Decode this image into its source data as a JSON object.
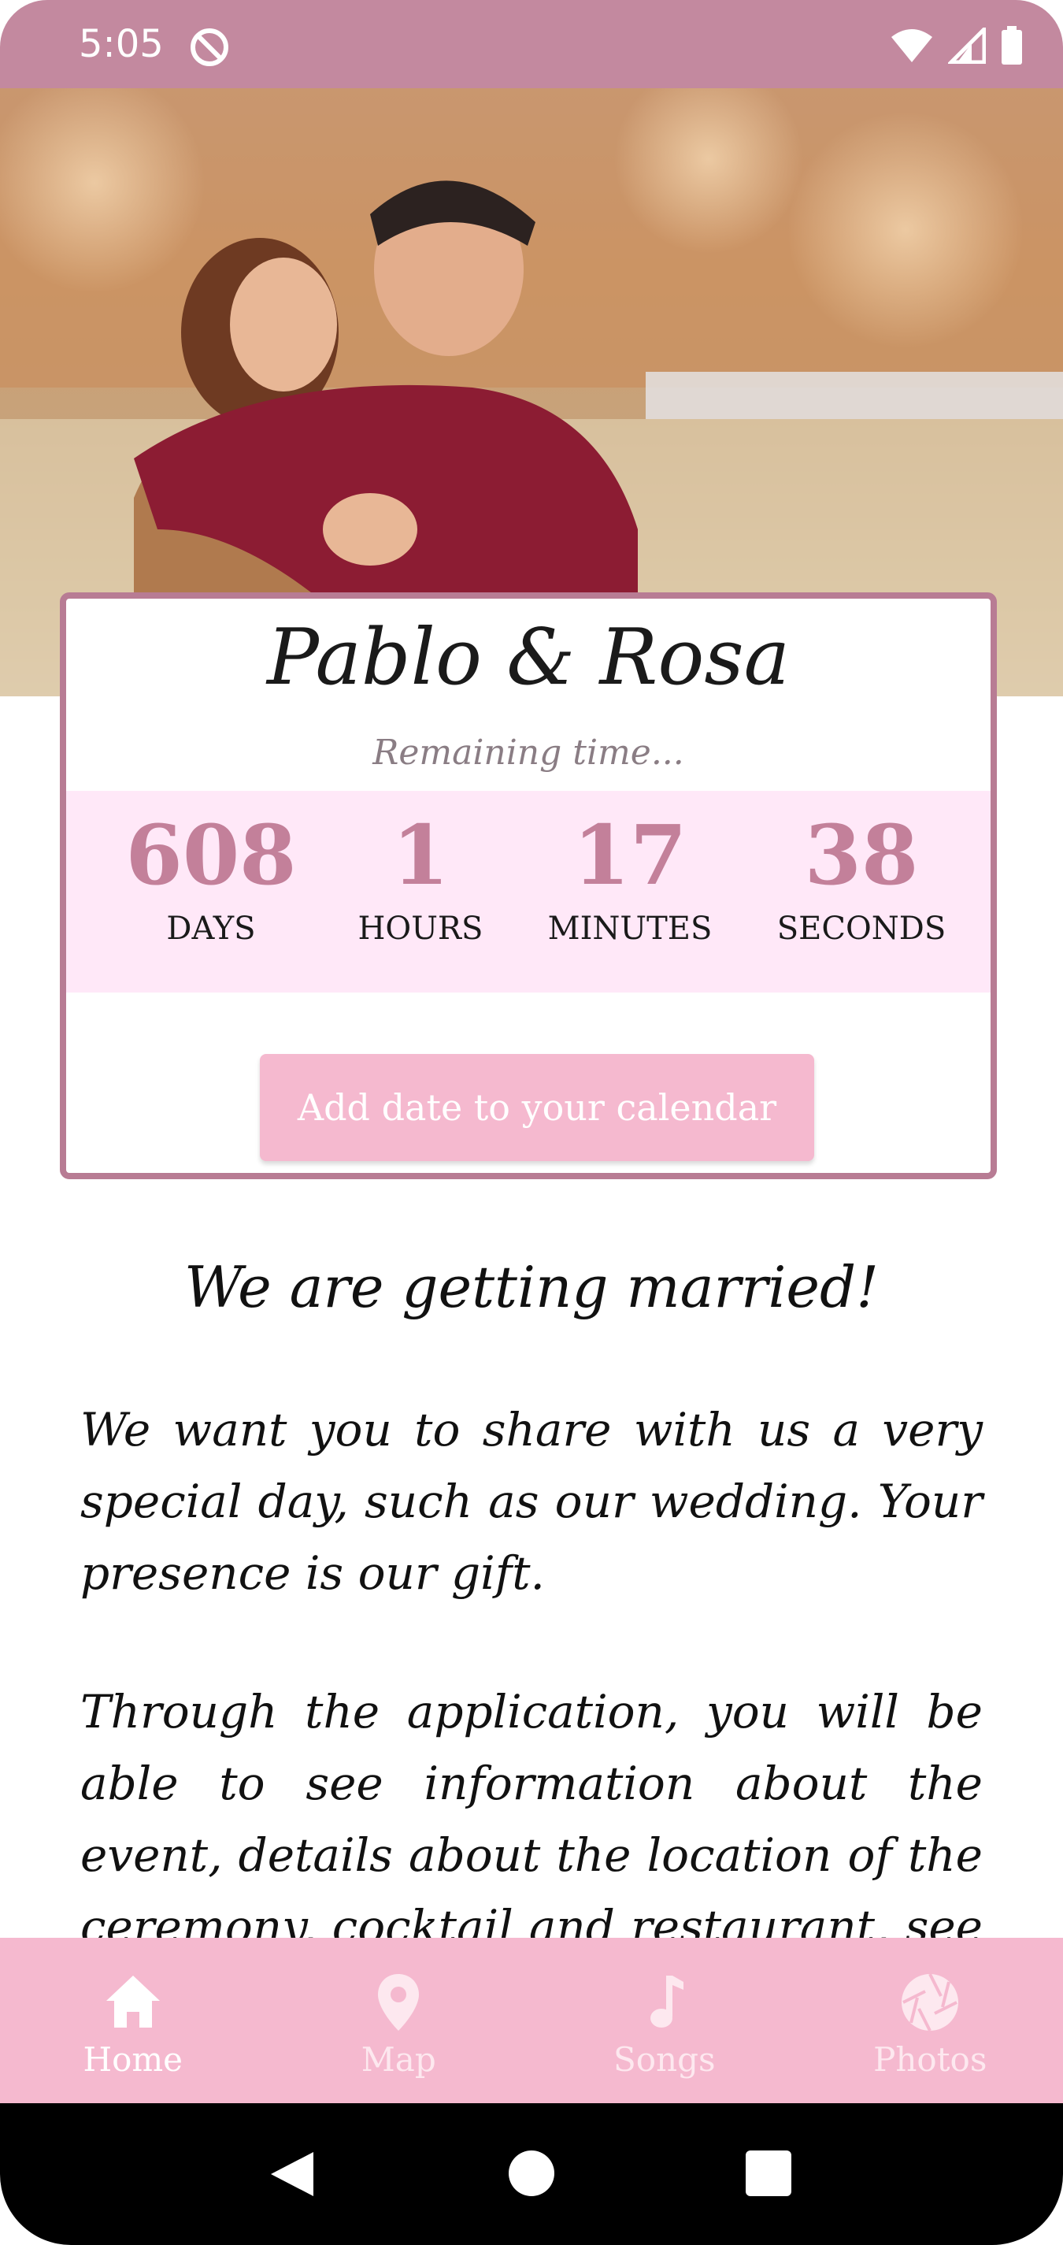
{
  "status_bar": {
    "time": "5:05",
    "icons": [
      "dnd-icon",
      "wifi-icon",
      "signal-icon",
      "battery-icon"
    ]
  },
  "hero": {
    "alt": "couple-photo"
  },
  "card": {
    "names": "Pablo & Rosa",
    "remaining": "Remaining time...",
    "counters": [
      {
        "value": "608",
        "label": "DAYS"
      },
      {
        "value": "1",
        "label": "HOURS"
      },
      {
        "value": "17",
        "label": "MINUTES"
      },
      {
        "value": "38",
        "label": "SECONDS"
      }
    ],
    "calendar_button": "Add date to your calendar"
  },
  "content": {
    "heading": "We are getting married!",
    "paragraph1": "We want you to share with us a very special day, such as our wedding. Your presence is our gift.",
    "paragraph2": "Through the application, you will be able to see information about the event, details about the location of the ceremony, cocktail and restaurant, see the photos of"
  },
  "bottom_nav": {
    "items": [
      {
        "label": "Home",
        "icon": "home-icon",
        "active": true
      },
      {
        "label": "Map",
        "icon": "map-pin-icon",
        "active": false
      },
      {
        "label": "Songs",
        "icon": "music-note-icon",
        "active": false
      },
      {
        "label": "Photos",
        "icon": "camera-aperture-icon",
        "active": false
      }
    ]
  },
  "colors": {
    "status_bar": "#c3899f",
    "accent_pink": "#f5b9cf",
    "counter_band": "#ffe8f8",
    "counter_number": "#c3809a",
    "card_border": "#b87c94"
  }
}
